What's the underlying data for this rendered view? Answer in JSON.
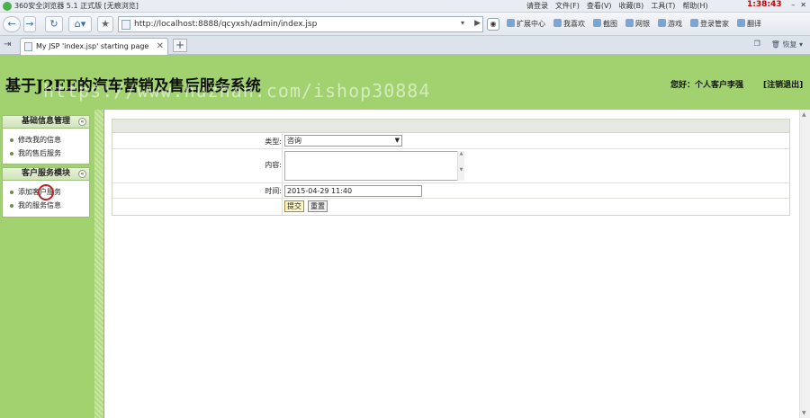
{
  "browser": {
    "title": "360安全浏览器 5.1 正式版 [无痕浏览]",
    "menu": [
      "请登录",
      "文件(F)",
      "查看(V)",
      "收藏(B)",
      "工具(T)",
      "帮助(H)"
    ],
    "clock": "1:38:43",
    "url": "http://localhost:8888/qcyxsh/admin/index.jsp",
    "toolbar_links": [
      "扩展中心",
      "我喜欢",
      "截图",
      "网银",
      "游戏",
      "登录管家",
      "翻译"
    ],
    "tab_title": "My JSP 'index.jsp' starting page",
    "tab_restore": "恢复"
  },
  "header": {
    "title": "基于J2EE的汽车营销及售后服务系统",
    "watermark": "https://www.huzhan.com/ishop30884",
    "greeting": "您好：个人客户李强",
    "logout": "[注销退出]"
  },
  "sidebar": {
    "groups": [
      {
        "title": "基础信息管理",
        "items": [
          "修改我的信息",
          "我的售后服务"
        ]
      },
      {
        "title": "客户服务模块",
        "items": [
          "添加客户服务",
          "我的服务信息"
        ]
      }
    ]
  },
  "form": {
    "type_label": "类型:",
    "type_value": "咨询",
    "content_label": "内容:",
    "content_value": "",
    "time_label": "时间:",
    "time_value": "2015-04-29 11:40",
    "submit_label": "提交",
    "reset_label": "重置"
  }
}
